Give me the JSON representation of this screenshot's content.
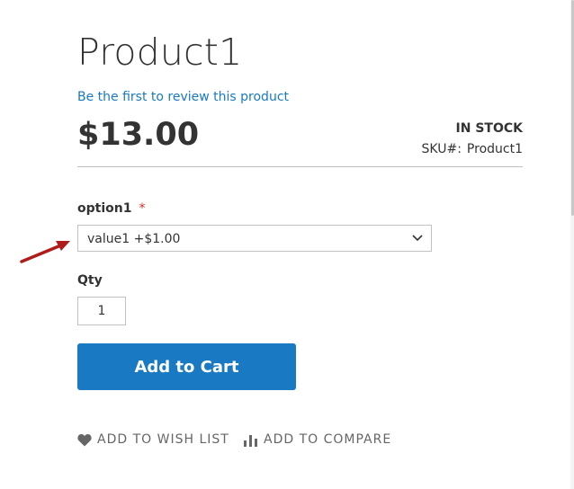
{
  "product": {
    "title": "Product1",
    "review_link": "Be the first to review this product",
    "price": "$13.00",
    "stock_status": "IN STOCK",
    "sku_label": "SKU#:",
    "sku_value": "Product1"
  },
  "options": {
    "label": "option1",
    "required_marker": "*",
    "selected_value": "value1 +$1.00"
  },
  "qty": {
    "label": "Qty",
    "value": "1"
  },
  "actions": {
    "add_to_cart": "Add to Cart",
    "wishlist": "ADD TO WISH LIST",
    "compare": "ADD TO COMPARE"
  },
  "colors": {
    "accent": "#1979c3",
    "required": "#e02b27",
    "annotation_arrow": "#b01c1c"
  },
  "icons": {
    "wishlist": "heart-icon",
    "compare": "bar-chart-icon",
    "select": "chevron-down-icon",
    "annotation": "red-arrow"
  }
}
